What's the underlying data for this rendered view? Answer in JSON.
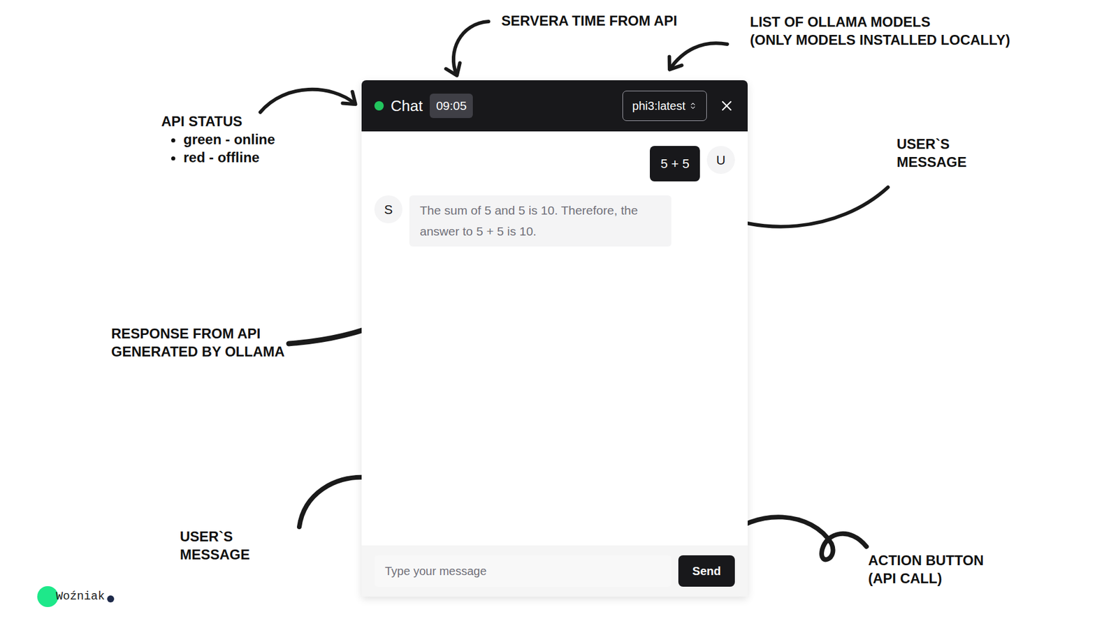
{
  "annotations": {
    "server_time": {
      "lines": [
        "SERVERA TIME FROM API"
      ]
    },
    "models": {
      "lines": [
        "LIST OF OLLAMA MODELS",
        "(ONLY MODELS INSTALLED LOCALLY)"
      ]
    },
    "api_status": {
      "lines": [
        "API STATUS"
      ],
      "bullets": [
        "green - online",
        "red - offline"
      ]
    },
    "user_message_top": {
      "lines": [
        "USER`S",
        "MESSAGE"
      ]
    },
    "response": {
      "lines": [
        "RESPONSE FROM API",
        "GENERATED BY OLLAMA"
      ]
    },
    "user_message_input": {
      "lines": [
        "USER`S",
        "MESSAGE"
      ]
    },
    "action_button": {
      "lines": [
        "ACTION BUTTON",
        "(API CALL)"
      ]
    }
  },
  "chat": {
    "title": "Chat",
    "online": true,
    "status_color": "#22c55e",
    "time": "09:05",
    "model": "phi3:latest",
    "messages": [
      {
        "role": "user",
        "avatar": "U",
        "text": "5 + 5"
      },
      {
        "role": "server",
        "avatar": "S",
        "text": "The sum of 5 and 5 is 10. Therefore, the answer to 5 + 5 is 10."
      }
    ],
    "input": {
      "placeholder": "Type your message"
    },
    "send_button": "Send"
  },
  "logo": {
    "text": "Woźniak"
  }
}
